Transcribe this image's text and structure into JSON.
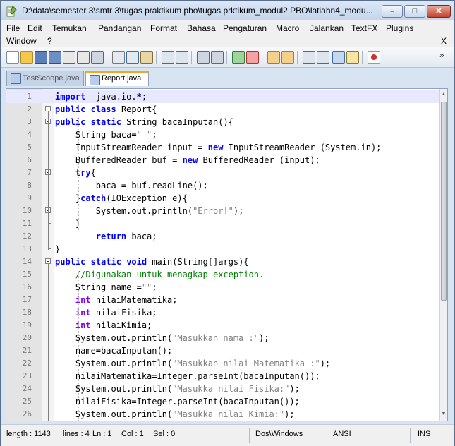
{
  "window": {
    "title": "D:\\data\\semester 3\\smtr 3\\tugas praktikum pbo\\tugas prktikum_modul2 PBO\\latiahn4_modu...",
    "min_label": "–",
    "max_label": "□",
    "close_label": "✕"
  },
  "menu": {
    "items": [
      "File",
      "Edit",
      "Temukan",
      "Pandangan",
      "Format",
      "Bahasa",
      "Pengaturan",
      "Macro",
      "Jalankan",
      "TextFX",
      "Plugins"
    ],
    "row2": [
      "Window",
      "?"
    ],
    "close_doc": "X"
  },
  "toolbar": {
    "icons": [
      "new-file-icon",
      "open-file-icon",
      "save-icon",
      "save-all-icon",
      "close-icon",
      "close-all-icon",
      "print-icon",
      "cut-icon",
      "copy-icon",
      "paste-icon",
      "undo-icon",
      "redo-icon",
      "find-icon",
      "replace-icon",
      "zoom-in-icon",
      "zoom-out-icon",
      "sync-vertical-icon",
      "sync-horizontal-icon",
      "word-wrap-icon",
      "show-all-chars-icon",
      "indent-guide-icon",
      "user-lang-icon",
      "record-macro-icon"
    ],
    "overflow": "»"
  },
  "tabs": [
    {
      "label": "TestScoope.java",
      "active": false
    },
    {
      "label": "Report.java",
      "active": true
    }
  ],
  "editor": {
    "lines": [
      {
        "n": "1",
        "segs": [
          [
            "kw",
            "import"
          ],
          [
            "",
            "  java.io."
          ],
          [
            "op",
            "*"
          ],
          [
            "",
            ";"
          ]
        ]
      },
      {
        "n": "2",
        "segs": [
          [
            "kw",
            "public"
          ],
          [
            "",
            " "
          ],
          [
            "kw",
            "class"
          ],
          [
            "",
            " Report{"
          ]
        ]
      },
      {
        "n": "3",
        "segs": [
          [
            "kw",
            "public"
          ],
          [
            "",
            " "
          ],
          [
            "kw",
            "static"
          ],
          [
            "",
            " String bacaInputan(){"
          ]
        ]
      },
      {
        "n": "4",
        "segs": [
          [
            "",
            "    String baca="
          ],
          [
            "str",
            "\" \""
          ],
          [
            "",
            ";"
          ]
        ]
      },
      {
        "n": "5",
        "segs": [
          [
            "",
            "    InputStreamReader input = "
          ],
          [
            "kw",
            "new"
          ],
          [
            "",
            " InputStreamReader (System.in);"
          ]
        ]
      },
      {
        "n": "6",
        "segs": [
          [
            "",
            "    BufferedReader buf = "
          ],
          [
            "kw",
            "new"
          ],
          [
            "",
            " BufferedReader (input);"
          ]
        ]
      },
      {
        "n": "7",
        "segs": [
          [
            "",
            "    "
          ],
          [
            "kw",
            "try"
          ],
          [
            "",
            "{"
          ]
        ]
      },
      {
        "n": "8",
        "segs": [
          [
            "",
            "        baca = buf.readLine();"
          ]
        ]
      },
      {
        "n": "9",
        "segs": [
          [
            "",
            "    }"
          ],
          [
            "kw",
            "catch"
          ],
          [
            "",
            "(IOException e){"
          ]
        ]
      },
      {
        "n": "10",
        "segs": [
          [
            "",
            "        System.out.println("
          ],
          [
            "str",
            "\"Error!\""
          ],
          [
            "",
            ");"
          ]
        ]
      },
      {
        "n": "11",
        "segs": [
          [
            "",
            "    }"
          ]
        ]
      },
      {
        "n": "12",
        "segs": [
          [
            "",
            "        "
          ],
          [
            "kw",
            "return"
          ],
          [
            "",
            " baca;"
          ]
        ]
      },
      {
        "n": "13",
        "segs": [
          [
            "",
            "}"
          ]
        ]
      },
      {
        "n": "14",
        "segs": [
          [
            "kw",
            "public"
          ],
          [
            "",
            " "
          ],
          [
            "kw",
            "static"
          ],
          [
            "",
            " "
          ],
          [
            "kw",
            "void"
          ],
          [
            "",
            " main(String[]args){"
          ]
        ]
      },
      {
        "n": "15",
        "segs": [
          [
            "",
            "    "
          ],
          [
            "cm",
            "//Digunakan untuk menagkap exception."
          ]
        ]
      },
      {
        "n": "16",
        "segs": [
          [
            "",
            "    String name ="
          ],
          [
            "str",
            "\"\""
          ],
          [
            "",
            ";"
          ]
        ]
      },
      {
        "n": "17",
        "segs": [
          [
            "",
            "    "
          ],
          [
            "ty",
            "int"
          ],
          [
            "",
            " nilaiMatematika;"
          ]
        ]
      },
      {
        "n": "18",
        "segs": [
          [
            "",
            "    "
          ],
          [
            "ty",
            "int"
          ],
          [
            "",
            " nilaiFisika;"
          ]
        ]
      },
      {
        "n": "19",
        "segs": [
          [
            "",
            "    "
          ],
          [
            "ty",
            "int"
          ],
          [
            "",
            " nilaiKimia;"
          ]
        ]
      },
      {
        "n": "20",
        "segs": [
          [
            "",
            "    System.out.println("
          ],
          [
            "str",
            "\"Masukkan nama :\""
          ],
          [
            "",
            ");"
          ]
        ]
      },
      {
        "n": "21",
        "segs": [
          [
            "",
            "    name=bacaInputan();"
          ]
        ]
      },
      {
        "n": "22",
        "segs": [
          [
            "",
            "    System.out.println("
          ],
          [
            "str",
            "\"Masukkan nilai Matematika :\""
          ],
          [
            "",
            ");"
          ]
        ]
      },
      {
        "n": "23",
        "segs": [
          [
            "",
            "    nilaiMatematika=Integer.parseInt(bacaInputan());"
          ]
        ]
      },
      {
        "n": "24",
        "segs": [
          [
            "",
            "    System.out.println("
          ],
          [
            "str",
            "\"Masukka nilai Fisika:\""
          ],
          [
            "",
            ");"
          ]
        ]
      },
      {
        "n": "25",
        "segs": [
          [
            "",
            "    nilaiFisika=Integer.parseInt(bacaInputan());"
          ]
        ]
      },
      {
        "n": "26",
        "segs": [
          [
            "",
            "    System.out.println("
          ],
          [
            "str",
            "\"Masukka nilai Kimia:\""
          ],
          [
            "",
            ");"
          ]
        ]
      }
    ]
  },
  "status": {
    "length": "length : 1143",
    "lines": "lines : 4",
    "ln": "Ln : 1",
    "col": "Col : 1",
    "sel": "Sel : 0",
    "eol": "Dos\\Windows",
    "encoding": "ANSI",
    "mode": "INS"
  },
  "colors": {
    "keyword": "#0000ff",
    "type": "#8000ff",
    "string": "#808080",
    "comment": "#008000",
    "current_line": "#e8e8ff"
  }
}
